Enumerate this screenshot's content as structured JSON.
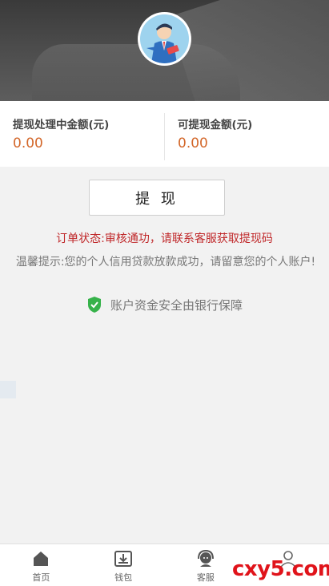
{
  "header": {
    "avatar": "avatar-illustration"
  },
  "amounts": {
    "processing_label": "提现处理中金额(元)",
    "processing_value": "0.00",
    "available_label": "可提现金额(元)",
    "available_value": "0.00",
    "value_color": "#d3672a"
  },
  "withdraw": {
    "button_label": "提 现"
  },
  "status": {
    "text": "订单状态:审核通功，请联系客服获取提现码",
    "color": "#c0282a"
  },
  "notice": {
    "text": "温馨提示:您的个人信用贷款放款成功，请留意您的个人账户!"
  },
  "security": {
    "text": "账户资金安全由银行保障",
    "icon": "shield-check-icon",
    "icon_color": "#36b24a"
  },
  "tabbar": {
    "items": [
      {
        "label": "首页",
        "icon": "home-icon"
      },
      {
        "label": "钱包",
        "icon": "wallet-download-icon"
      },
      {
        "label": "客服",
        "icon": "customer-service-icon"
      },
      {
        "label": "",
        "icon": "user-icon"
      }
    ]
  },
  "watermark": {
    "text": "cxy5.com"
  }
}
